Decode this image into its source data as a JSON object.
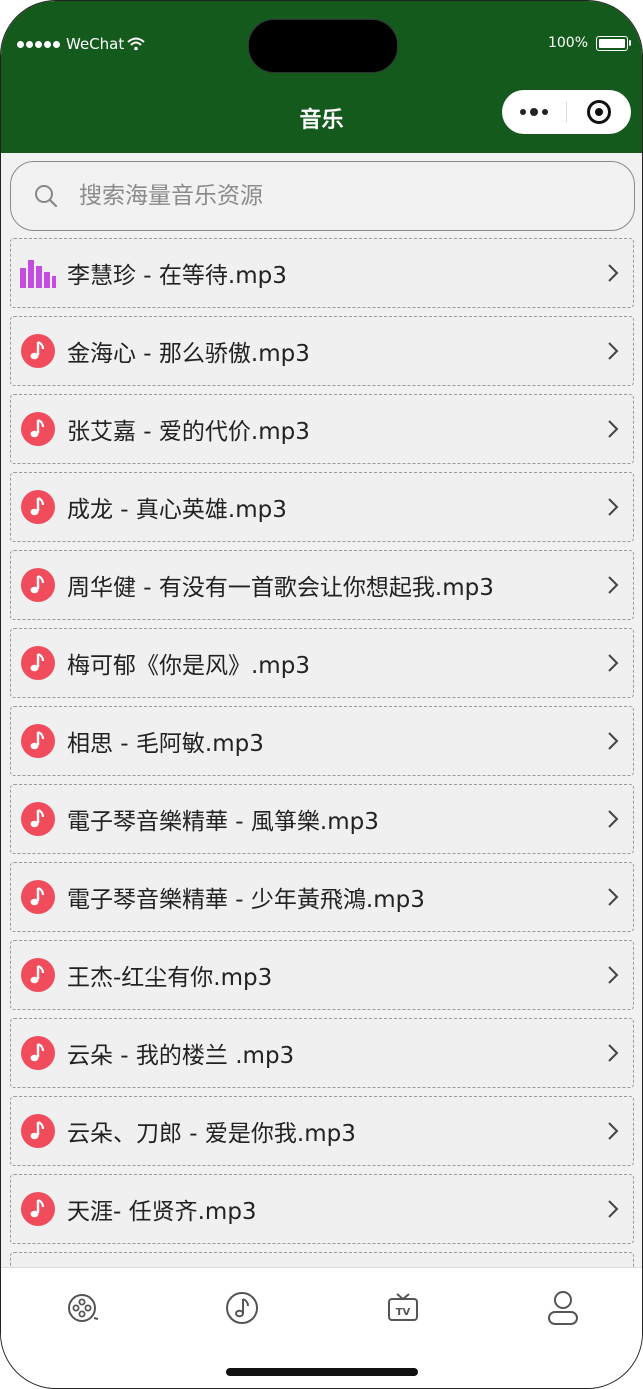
{
  "status_bar": {
    "carrier": "WeChat",
    "battery": "100%"
  },
  "header": {
    "title": "音乐"
  },
  "capsule": {
    "more_icon": "more-dots-icon",
    "close_icon": "target-icon"
  },
  "search": {
    "placeholder": "搜索海量音乐资源",
    "value": ""
  },
  "songs": [
    {
      "title": "李慧珍 - 在等待.mp3",
      "playing": true
    },
    {
      "title": "金海心 - 那么骄傲.mp3",
      "playing": false
    },
    {
      "title": "张艾嘉 - 爱的代价.mp3",
      "playing": false
    },
    {
      "title": "成龙 - 真心英雄.mp3",
      "playing": false
    },
    {
      "title": "周华健 - 有没有一首歌会让你想起我.mp3",
      "playing": false
    },
    {
      "title": "梅可郁《你是风》.mp3",
      "playing": false
    },
    {
      "title": "相思 - 毛阿敏.mp3",
      "playing": false
    },
    {
      "title": "電子琴音樂精華 - 風箏樂.mp3",
      "playing": false
    },
    {
      "title": "電子琴音樂精華 - 少年黃飛鴻.mp3",
      "playing": false
    },
    {
      "title": "王杰-红尘有你.mp3",
      "playing": false
    },
    {
      "title": "云朵 - 我的楼兰 .mp3",
      "playing": false
    },
    {
      "title": "云朵、刀郎 - 爱是你我.mp3",
      "playing": false
    },
    {
      "title": "天涯- 任贤齐.mp3",
      "playing": false
    }
  ],
  "tabbar": {
    "items": [
      {
        "icon": "film-reel-icon"
      },
      {
        "icon": "music-note-icon",
        "active": true
      },
      {
        "icon": "tv-icon"
      },
      {
        "icon": "user-icon"
      }
    ]
  },
  "colors": {
    "header_bg": "#155a1d",
    "note_red": "#f04c5c",
    "playing_purple": "#c44de0"
  }
}
